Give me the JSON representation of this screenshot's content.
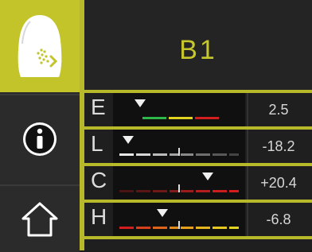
{
  "shade": "B1",
  "icons": {
    "tooth_measure": "tooth-measure-icon",
    "info": "info-icon",
    "home": "home-icon"
  },
  "colors": {
    "accent": "#c3c42a",
    "green": "#2fb84a",
    "yellow": "#e0d420",
    "red": "#d21e1e",
    "orange": "#e38a1c"
  },
  "rows": [
    {
      "letter": "E",
      "value": "2.5",
      "marker_fraction": 0.17,
      "center_tick": false,
      "segments": [
        {
          "start": 0.19,
          "end": 0.39,
          "color": "#2fb84a"
        },
        {
          "start": 0.41,
          "end": 0.61,
          "color": "#e0d420"
        },
        {
          "start": 0.63,
          "end": 0.83,
          "color": "#d21e1e"
        }
      ]
    },
    {
      "letter": "L",
      "value": "-18.2",
      "marker_fraction": 0.07,
      "center_tick": true,
      "segments": [
        {
          "start": 0.0,
          "end": 0.12,
          "color": "#e8e8e8"
        },
        {
          "start": 0.14,
          "end": 0.26,
          "color": "#d6d6d6"
        },
        {
          "start": 0.28,
          "end": 0.4,
          "color": "#bcbcbc"
        },
        {
          "start": 0.42,
          "end": 0.49,
          "color": "#a4a4a4"
        },
        {
          "start": 0.51,
          "end": 0.62,
          "color": "#8a8a8a"
        },
        {
          "start": 0.64,
          "end": 0.76,
          "color": "#6e6e6e"
        },
        {
          "start": 0.78,
          "end": 0.9,
          "color": "#585858"
        },
        {
          "start": 0.92,
          "end": 1.0,
          "color": "#444444"
        }
      ]
    },
    {
      "letter": "C",
      "value": "+20.4",
      "marker_fraction": 0.74,
      "center_tick": true,
      "segments": [
        {
          "start": 0.0,
          "end": 0.12,
          "color": "#4a1414"
        },
        {
          "start": 0.14,
          "end": 0.26,
          "color": "#5a1616"
        },
        {
          "start": 0.28,
          "end": 0.4,
          "color": "#6e1818"
        },
        {
          "start": 0.42,
          "end": 0.49,
          "color": "#841a1a"
        },
        {
          "start": 0.51,
          "end": 0.62,
          "color": "#9c1c1c"
        },
        {
          "start": 0.64,
          "end": 0.76,
          "color": "#b41e1e"
        },
        {
          "start": 0.78,
          "end": 0.9,
          "color": "#c81e1e"
        },
        {
          "start": 0.92,
          "end": 1.0,
          "color": "#d21e1e"
        }
      ]
    },
    {
      "letter": "H",
      "value": "-6.8",
      "marker_fraction": 0.36,
      "center_tick": true,
      "segments": [
        {
          "start": 0.0,
          "end": 0.12,
          "color": "#d21e1e"
        },
        {
          "start": 0.14,
          "end": 0.26,
          "color": "#d8401c"
        },
        {
          "start": 0.28,
          "end": 0.4,
          "color": "#de641c"
        },
        {
          "start": 0.42,
          "end": 0.49,
          "color": "#e38a1c"
        },
        {
          "start": 0.51,
          "end": 0.62,
          "color": "#e6a01e"
        },
        {
          "start": 0.64,
          "end": 0.76,
          "color": "#e6b41e"
        },
        {
          "start": 0.78,
          "end": 0.9,
          "color": "#e6c620"
        },
        {
          "start": 0.92,
          "end": 1.0,
          "color": "#e0d420"
        }
      ]
    }
  ]
}
